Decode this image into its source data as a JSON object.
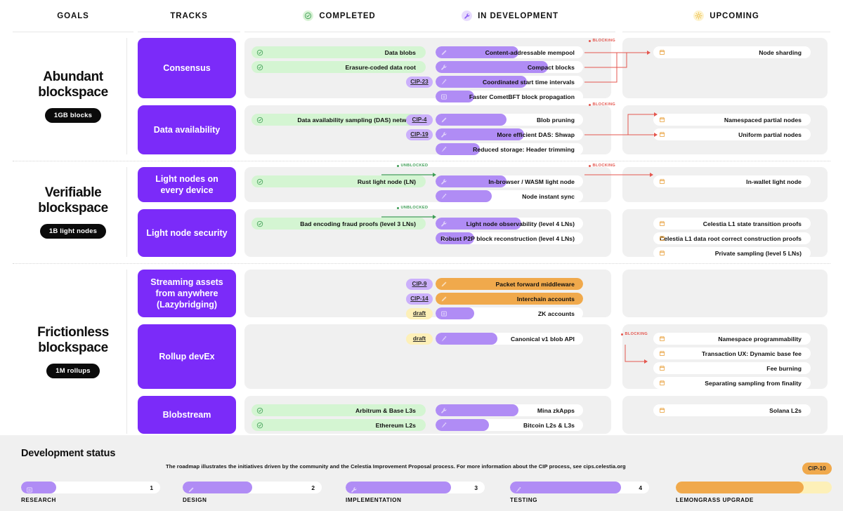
{
  "columns": [
    {
      "key": "goals",
      "label": "GOALS",
      "icon": null
    },
    {
      "key": "tracks",
      "label": "TRACKS",
      "icon": null
    },
    {
      "key": "completed",
      "label": "COMPLETED",
      "icon": "check-circle-icon"
    },
    {
      "key": "in_development",
      "label": "IN DEVELOPMENT",
      "icon": "wrench-icon"
    },
    {
      "key": "upcoming",
      "label": "UPCOMING",
      "icon": "sun-icon"
    }
  ],
  "colors": {
    "track_purple": "#7b2bf9",
    "progress_purple": "#b08cf5",
    "completed_green": "#d4f5d2",
    "upcoming_orange": "#f0a94c",
    "blocking_red": "#e4574f",
    "unblocked_green": "#3f9e56",
    "cip_badge": "#cbb0fb",
    "draft_badge": "#fdf0b8"
  },
  "goals": [
    {
      "title": "Abundant blockspace",
      "badge": "1GB blocks",
      "tracks": [
        {
          "name": "Consensus",
          "completed": [
            {
              "label": "Data blobs"
            },
            {
              "label": "Erasure-coded data root"
            }
          ],
          "in_development": [
            {
              "label": "Content-addressable mempool",
              "stage": "design",
              "progress": 56,
              "cip": null
            },
            {
              "label": "Compact blocks",
              "stage": "implementation",
              "progress": 76,
              "cip": null
            },
            {
              "label": "Coordinated start time intervals",
              "stage": "testing",
              "progress": 62,
              "cip": "CIP-23"
            },
            {
              "label": "Faster CometBFT block propagation",
              "stage": "research",
              "progress": 26,
              "cip": null
            }
          ],
          "upcoming": [
            {
              "label": "Node sharding"
            }
          ]
        },
        {
          "name": "Data availability",
          "completed": [
            {
              "label": "Data availability sampling (DAS) network"
            }
          ],
          "in_development": [
            {
              "label": "Blob pruning",
              "stage": "design",
              "progress": 48,
              "cip": "CIP-4"
            },
            {
              "label": "More efficient DAS: Shwap",
              "stage": "implementation",
              "progress": 60,
              "cip": "CIP-19"
            },
            {
              "label": "Reduced storage: Header trimming",
              "stage": "testing",
              "progress": 30,
              "cip": null
            }
          ],
          "upcoming": [
            {
              "label": "Namespaced partial nodes"
            },
            {
              "label": "Uniform partial nodes"
            }
          ]
        }
      ]
    },
    {
      "title": "Verifiable blockspace",
      "badge": "1B light nodes",
      "tracks": [
        {
          "name": "Light nodes on every device",
          "completed": [
            {
              "label": "Rust light node (LN)"
            }
          ],
          "in_development": [
            {
              "label": "In-browser / WASM light node",
              "stage": "implementation",
              "progress": 48,
              "cip": null
            },
            {
              "label": "Node instant sync",
              "stage": "testing",
              "progress": 38,
              "cip": null
            }
          ],
          "upcoming": [
            {
              "label": "In-wallet light node"
            }
          ]
        },
        {
          "name": "Light node security",
          "completed": [
            {
              "label": "Bad encoding fraud proofs (level 3 LNs)"
            }
          ],
          "in_development": [
            {
              "label": "Light node observability (level 4 LNs)",
              "stage": "implementation",
              "progress": 58,
              "cip": null
            },
            {
              "label": "Robust P2P block reconstruction (level 4 LNs)",
              "stage": "research",
              "progress": 26,
              "cip": null
            }
          ],
          "upcoming": [
            {
              "label": "Celestia L1 state transition proofs"
            },
            {
              "label": "Celestia L1 data root correct construction proofs"
            },
            {
              "label": "Private sampling (level 5 LNs)"
            }
          ]
        }
      ]
    },
    {
      "title": "Frictionless blockspace",
      "badge": "1M rollups",
      "tracks": [
        {
          "name": "Streaming assets from anywhere (Lazybridging)",
          "completed": [],
          "in_development": [
            {
              "label": "Packet forward middleware",
              "stage": "design",
              "progress": 100,
              "cip": "CIP-9",
              "orange": true
            },
            {
              "label": "Interchain accounts",
              "stage": "design",
              "progress": 100,
              "cip": "CIP-14",
              "orange": true
            },
            {
              "label": "ZK accounts",
              "stage": "research",
              "progress": 26,
              "cip": "draft"
            }
          ],
          "upcoming": []
        },
        {
          "name": "Rollup devEx",
          "completed": [],
          "in_development": [
            {
              "label": "Canonical v1 blob API",
              "stage": "testing",
              "progress": 42,
              "cip": "draft"
            }
          ],
          "upcoming": [
            {
              "label": "Namespace programmability"
            },
            {
              "label": "Transaction UX: Dynamic base fee"
            },
            {
              "label": "Fee burning"
            },
            {
              "label": "Separating sampling from finality"
            }
          ]
        },
        {
          "name": "Blobstream",
          "completed": [
            {
              "label": "Arbitrum & Base L3s"
            },
            {
              "label": "Ethereum L2s"
            }
          ],
          "in_development": [
            {
              "label": "Mina zkApps",
              "stage": "implementation",
              "progress": 56,
              "cip": null
            },
            {
              "label": "Bitcoin L2s & L3s",
              "stage": "testing",
              "progress": 36,
              "cip": null
            }
          ],
          "upcoming": [
            {
              "label": "Solana L2s"
            }
          ]
        }
      ]
    }
  ],
  "connector_labels": {
    "blocking": "BLOCKING",
    "unblocked": "UNBLOCKED"
  },
  "footer": {
    "title": "Development status",
    "description": "The roadmap illustrates the initiatives driven by the community and the Celestia Improvement Proposal process. For more information about the CIP process, see cips.celestia.org",
    "stages": [
      {
        "num": "1",
        "caption": "RESEARCH",
        "icon": "book-icon",
        "progress": 25
      },
      {
        "num": "2",
        "caption": "DESIGN",
        "icon": "pencil-icon",
        "progress": 50
      },
      {
        "num": "3",
        "caption": "IMPLEMENTATION",
        "icon": "wrench-icon",
        "progress": 76
      },
      {
        "num": "4",
        "caption": "TESTING",
        "icon": "pen-nib-icon",
        "progress": 80
      }
    ],
    "lemongrass": {
      "caption": "LEMONGRASS UPGRADE",
      "badge": "CIP-10",
      "progress": 82
    }
  }
}
